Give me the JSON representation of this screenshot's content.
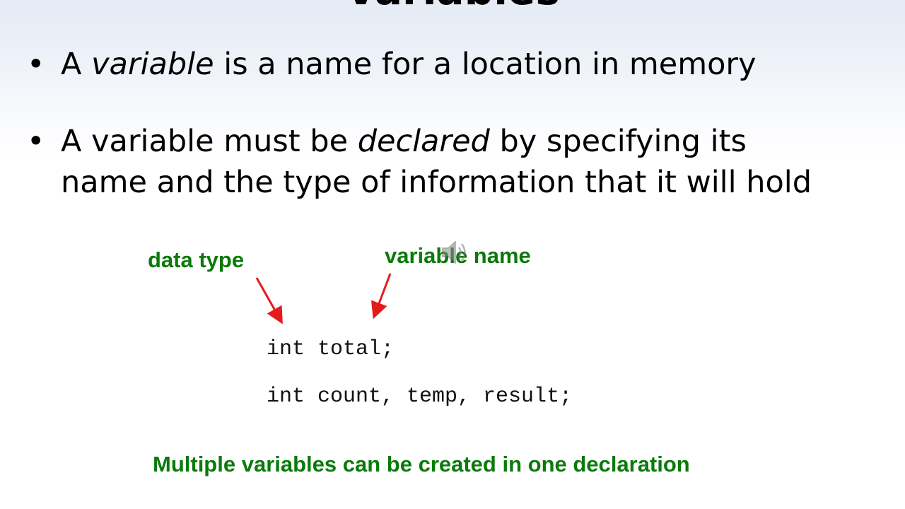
{
  "slide": {
    "title": "Variables"
  },
  "bullets": [
    {
      "marker": "•",
      "line1_prefix": "A ",
      "line1_em": "variable",
      "line1_suffix": " is a name for a location in memory"
    },
    {
      "marker": "•",
      "line1_prefix": "A variable must be ",
      "line1_em": "declared",
      "line1_suffix": " by specifying its",
      "line2": "name and the type of information that it will hold"
    }
  ],
  "annotations": {
    "data_type": "data type",
    "variable_name": "variable name",
    "note": "Multiple variables can be created in one declaration"
  },
  "code": [
    "int total;",
    "int count, temp, result;"
  ],
  "colors": {
    "annotation_green": "#0a7a0a",
    "arrow_red": "#e41b1b"
  },
  "icons": {
    "speaker": "speaker-icon"
  }
}
